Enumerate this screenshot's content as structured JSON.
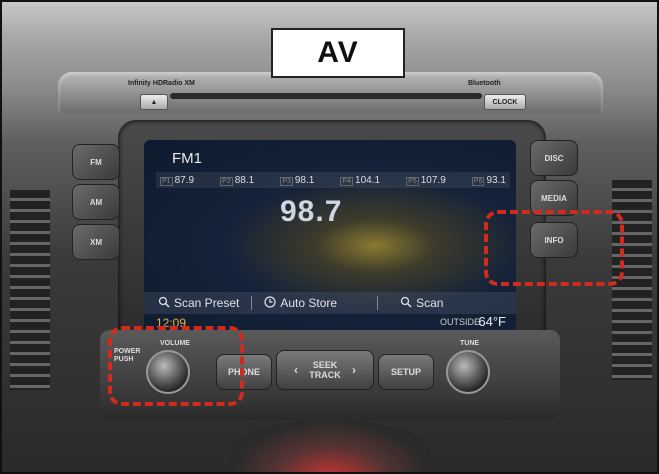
{
  "label": "AV",
  "top_panel": {
    "eject": "▲",
    "clock_btn": "CLOCK",
    "brand_left": "Infinity  HDRadio  XM",
    "brand_right": "Bluetooth"
  },
  "screen": {
    "mode": "FM1",
    "presets": [
      {
        "n": "P1",
        "f": "87.9"
      },
      {
        "n": "P2",
        "f": "88.1"
      },
      {
        "n": "P3",
        "f": "98.1"
      },
      {
        "n": "P4",
        "f": "104.1"
      },
      {
        "n": "P5",
        "f": "107.9"
      },
      {
        "n": "P6",
        "f": "93.1"
      }
    ],
    "frequency": "98.7",
    "scan_preset": "Scan Preset",
    "auto_store": "Auto Store",
    "scan": "Scan",
    "clock": "12:09",
    "outside_label": "OUTSIDE",
    "outside_temp": "64°F"
  },
  "left_buttons": [
    "FM",
    "AM",
    "XM"
  ],
  "right_buttons": [
    "DISC",
    "MEDIA",
    "INFO"
  ],
  "lower": {
    "power_label": "POWER PUSH",
    "volume_label": "VOLUME",
    "phone": "PHONE",
    "seek_track": "SEEK TRACK",
    "setup": "SETUP",
    "tune_label": "TUNE"
  },
  "highlight_color": "#d32a1e"
}
